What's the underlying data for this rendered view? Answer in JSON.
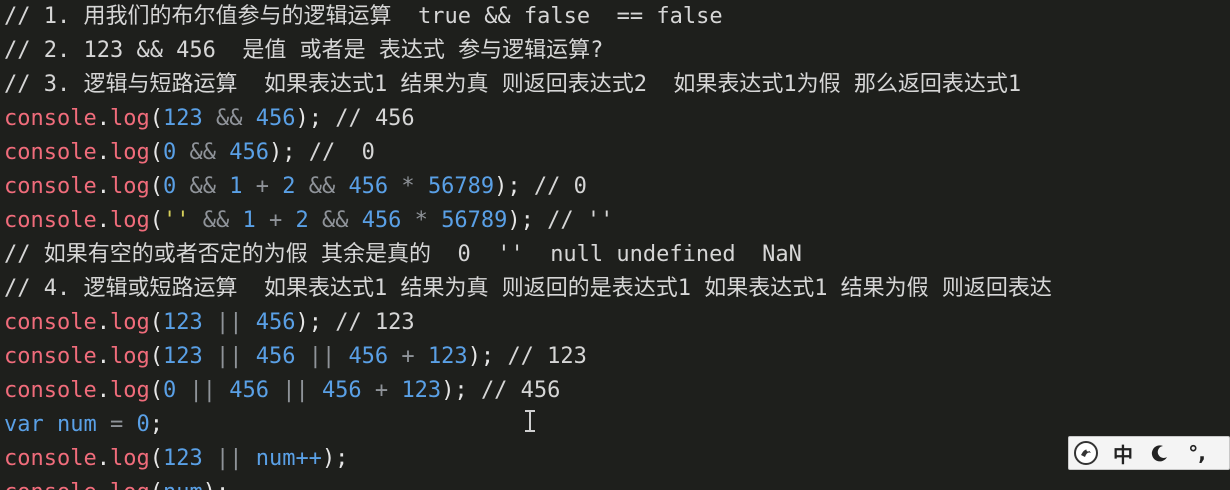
{
  "editor": {
    "lines": [
      {
        "segments": [
          {
            "c": "cmt",
            "t": "// 1. 用我们的布尔值参与的逻辑运算  true && false  == false"
          }
        ]
      },
      {
        "segments": [
          {
            "c": "cmt",
            "t": "// 2. 123 && 456  是值 或者是 表达式 参与逻辑运算?"
          }
        ]
      },
      {
        "segments": [
          {
            "c": "cmt",
            "t": "// 3. 逻辑与短路运算  如果表达式1 结果为真 则返回表达式2  如果表达式1为假 那么返回表达式1"
          }
        ]
      },
      {
        "segments": [
          {
            "c": "obj",
            "t": "console"
          },
          {
            "c": "punc",
            "t": "."
          },
          {
            "c": "obj",
            "t": "log"
          },
          {
            "c": "punc",
            "t": "("
          },
          {
            "c": "num",
            "t": "123"
          },
          {
            "c": "op",
            "t": " && "
          },
          {
            "c": "num",
            "t": "456"
          },
          {
            "c": "punc",
            "t": "); "
          },
          {
            "c": "cmt",
            "t": "// 456"
          }
        ]
      },
      {
        "segments": [
          {
            "c": "obj",
            "t": "console"
          },
          {
            "c": "punc",
            "t": "."
          },
          {
            "c": "obj",
            "t": "log"
          },
          {
            "c": "punc",
            "t": "("
          },
          {
            "c": "num",
            "t": "0"
          },
          {
            "c": "op",
            "t": " && "
          },
          {
            "c": "num",
            "t": "456"
          },
          {
            "c": "punc",
            "t": "); "
          },
          {
            "c": "cmt",
            "t": "//  0"
          }
        ]
      },
      {
        "segments": [
          {
            "c": "obj",
            "t": "console"
          },
          {
            "c": "punc",
            "t": "."
          },
          {
            "c": "obj",
            "t": "log"
          },
          {
            "c": "punc",
            "t": "("
          },
          {
            "c": "num",
            "t": "0"
          },
          {
            "c": "op",
            "t": " && "
          },
          {
            "c": "num",
            "t": "1"
          },
          {
            "c": "op",
            "t": " + "
          },
          {
            "c": "num",
            "t": "2"
          },
          {
            "c": "op",
            "t": " && "
          },
          {
            "c": "num",
            "t": "456"
          },
          {
            "c": "op",
            "t": " * "
          },
          {
            "c": "num",
            "t": "56789"
          },
          {
            "c": "punc",
            "t": "); "
          },
          {
            "c": "cmt",
            "t": "// 0"
          }
        ]
      },
      {
        "segments": [
          {
            "c": "obj",
            "t": "console"
          },
          {
            "c": "punc",
            "t": "."
          },
          {
            "c": "obj",
            "t": "log"
          },
          {
            "c": "punc",
            "t": "("
          },
          {
            "c": "str",
            "t": "''"
          },
          {
            "c": "op",
            "t": " && "
          },
          {
            "c": "num",
            "t": "1"
          },
          {
            "c": "op",
            "t": " + "
          },
          {
            "c": "num",
            "t": "2"
          },
          {
            "c": "op",
            "t": " && "
          },
          {
            "c": "num",
            "t": "456"
          },
          {
            "c": "op",
            "t": " * "
          },
          {
            "c": "num",
            "t": "56789"
          },
          {
            "c": "punc",
            "t": "); "
          },
          {
            "c": "cmt",
            "t": "// ''"
          }
        ]
      },
      {
        "segments": [
          {
            "c": "cmt",
            "t": "// 如果有空的或者否定的为假 其余是真的  0  ''  null undefined  NaN"
          }
        ]
      },
      {
        "segments": [
          {
            "c": "cmt",
            "t": "// 4. 逻辑或短路运算  如果表达式1 结果为真 则返回的是表达式1 如果表达式1 结果为假 则返回表达"
          }
        ]
      },
      {
        "segments": [
          {
            "c": "obj",
            "t": "console"
          },
          {
            "c": "punc",
            "t": "."
          },
          {
            "c": "obj",
            "t": "log"
          },
          {
            "c": "punc",
            "t": "("
          },
          {
            "c": "num",
            "t": "123"
          },
          {
            "c": "op",
            "t": " || "
          },
          {
            "c": "num",
            "t": "456"
          },
          {
            "c": "punc",
            "t": "); "
          },
          {
            "c": "cmt",
            "t": "// 123"
          }
        ]
      },
      {
        "segments": [
          {
            "c": "obj",
            "t": "console"
          },
          {
            "c": "punc",
            "t": "."
          },
          {
            "c": "obj",
            "t": "log"
          },
          {
            "c": "punc",
            "t": "("
          },
          {
            "c": "num",
            "t": "123"
          },
          {
            "c": "op",
            "t": " || "
          },
          {
            "c": "num",
            "t": "456"
          },
          {
            "c": "op",
            "t": " || "
          },
          {
            "c": "num",
            "t": "456"
          },
          {
            "c": "op",
            "t": " + "
          },
          {
            "c": "num",
            "t": "123"
          },
          {
            "c": "punc",
            "t": "); "
          },
          {
            "c": "cmt",
            "t": "// 123"
          }
        ]
      },
      {
        "segments": [
          {
            "c": "obj",
            "t": "console"
          },
          {
            "c": "punc",
            "t": "."
          },
          {
            "c": "obj",
            "t": "log"
          },
          {
            "c": "punc",
            "t": "("
          },
          {
            "c": "num",
            "t": "0"
          },
          {
            "c": "op",
            "t": " || "
          },
          {
            "c": "num",
            "t": "456"
          },
          {
            "c": "op",
            "t": " || "
          },
          {
            "c": "num",
            "t": "456"
          },
          {
            "c": "op",
            "t": " + "
          },
          {
            "c": "num",
            "t": "123"
          },
          {
            "c": "punc",
            "t": "); "
          },
          {
            "c": "cmt",
            "t": "// 456"
          }
        ]
      },
      {
        "segments": [
          {
            "c": "kw",
            "t": "var"
          },
          {
            "c": "punc",
            "t": " "
          },
          {
            "c": "ident",
            "t": "num"
          },
          {
            "c": "op",
            "t": " = "
          },
          {
            "c": "num",
            "t": "0"
          },
          {
            "c": "punc",
            "t": ";"
          }
        ]
      },
      {
        "segments": [
          {
            "c": "obj",
            "t": "console"
          },
          {
            "c": "punc",
            "t": "."
          },
          {
            "c": "obj",
            "t": "log"
          },
          {
            "c": "punc",
            "t": "("
          },
          {
            "c": "num",
            "t": "123"
          },
          {
            "c": "op",
            "t": " || "
          },
          {
            "c": "ident",
            "t": "num++"
          },
          {
            "c": "punc",
            "t": ");"
          }
        ]
      },
      {
        "segments": [
          {
            "c": "obj",
            "t": "console"
          },
          {
            "c": "punc",
            "t": "."
          },
          {
            "c": "obj",
            "t": "log"
          },
          {
            "c": "punc",
            "t": "("
          },
          {
            "c": "ident",
            "t": "num"
          },
          {
            "c": "punc",
            "t": ");"
          }
        ]
      }
    ]
  },
  "ime_toolbar": {
    "logo_icon": "sogou-logo-icon",
    "language_label": "中",
    "moon_icon": "moon-icon",
    "punct_label": "°,"
  }
}
